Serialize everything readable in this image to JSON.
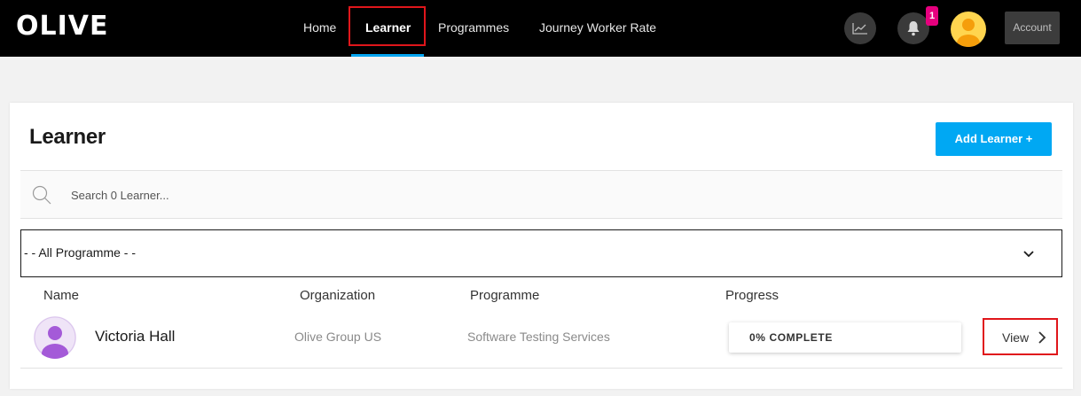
{
  "brand": {
    "logo_text": "OLIVE"
  },
  "nav": {
    "items": [
      {
        "label": "Home"
      },
      {
        "label": "Learner"
      },
      {
        "label": "Programmes"
      },
      {
        "label": "Journey Worker Rate"
      }
    ],
    "active": "Learner"
  },
  "header_right": {
    "notification_count": "1",
    "account_label": "Account",
    "icons": [
      "trend-chart-icon",
      "bell-icon",
      "user-avatar-icon"
    ]
  },
  "page": {
    "title": "Learner",
    "add_button_label": "Add Learner +",
    "search": {
      "placeholder": "Search 0 Learner..."
    },
    "programme_filter": {
      "selected": "- - All Programme - -"
    }
  },
  "table": {
    "columns": [
      "Name",
      "Organization",
      "Programme",
      "Progress"
    ],
    "rows": [
      {
        "name": "Victoria Hall",
        "organization": "Olive Group US",
        "programme": "Software Testing Services",
        "progress_percent": 0,
        "progress_label": "0% COMPLETE",
        "action_label": "View"
      }
    ]
  },
  "colors": {
    "accent": "#00a8f3",
    "highlight_border": "#e0161b",
    "badge": "#e6007e",
    "topbar": "#000000"
  }
}
